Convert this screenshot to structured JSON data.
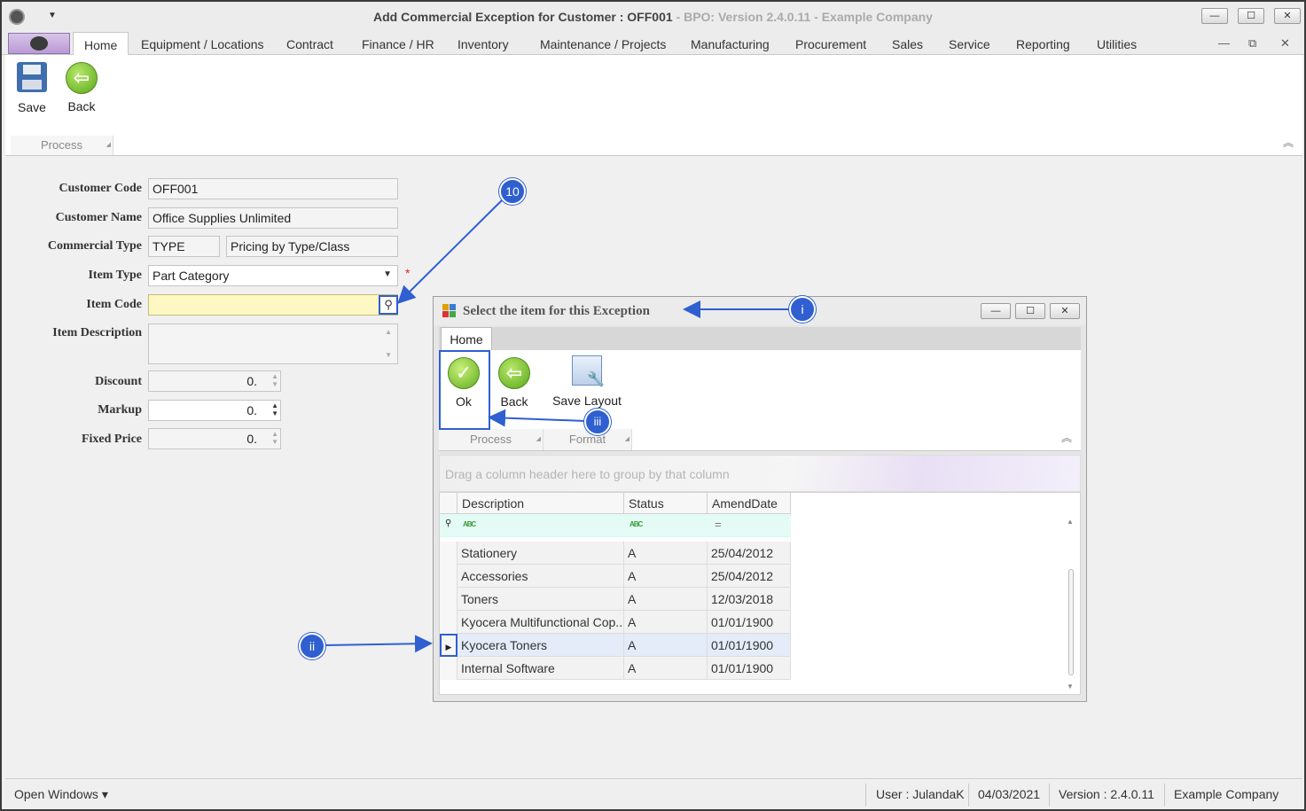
{
  "window": {
    "title_main": "Add Commercial Exception for Customer : OFF001",
    "title_dim": " - BPO: Version 2.4.0.11 - Example Company",
    "min": "—",
    "max": "☐",
    "close": "✕"
  },
  "tabs": {
    "home": "Home",
    "items": [
      "Equipment / Locations",
      "Contract",
      "Finance / HR",
      "Inventory",
      "Maintenance / Projects",
      "Manufacturing",
      "Procurement",
      "Sales",
      "Service",
      "Reporting",
      "Utilities"
    ]
  },
  "ribbon": {
    "save": "Save",
    "back": "Back",
    "process_group": "Process"
  },
  "form": {
    "customer_code_label": "Customer Code",
    "customer_code": "OFF001",
    "customer_name_label": "Customer Name",
    "customer_name": "Office Supplies Unlimited",
    "commercial_type_label": "Commercial Type",
    "commercial_type_code": "TYPE",
    "commercial_type_desc": "Pricing by Type/Class",
    "item_type_label": "Item Type",
    "item_type": "Part Category",
    "item_code_label": "Item Code",
    "item_code": "",
    "item_description_label": "Item Description",
    "discount_label": "Discount",
    "discount": "0.",
    "markup_label": "Markup",
    "markup": "0.",
    "fixed_price_label": "Fixed Price",
    "fixed_price": "0."
  },
  "dialog": {
    "title": "Select the item for this Exception",
    "tab_home": "Home",
    "ok": "Ok",
    "back": "Back",
    "save_layout": "Save Layout",
    "group_process": "Process",
    "group_format": "Format",
    "groupby_hint": "Drag a column header here to group by that column",
    "columns": [
      "Description",
      "Status",
      "AmendDate"
    ],
    "rows": [
      {
        "description": "Stationery",
        "status": "A",
        "date": "25/04/2012"
      },
      {
        "description": "Accessories",
        "status": "A",
        "date": "25/04/2012"
      },
      {
        "description": "Toners",
        "status": "A",
        "date": "12/03/2018"
      },
      {
        "description": "Kyocera Multifunctional Cop...",
        "status": "A",
        "date": "01/01/1900"
      },
      {
        "description": "Kyocera Toners",
        "status": "A",
        "date": "01/01/1900"
      },
      {
        "description": "Internal Software",
        "status": "A",
        "date": "01/01/1900"
      }
    ]
  },
  "statusbar": {
    "open_windows": "Open Windows ▾",
    "user": "User : JulandaK",
    "date": "04/03/2021",
    "version": "Version : 2.4.0.11",
    "company": "Example Company"
  },
  "annotations": {
    "b10": "10",
    "bi": "i",
    "bii": "ii",
    "biii": "iii"
  },
  "colors": {
    "accent": "#2f5fd0",
    "required": "#dd2222",
    "focus_field": "#fdf7c3"
  }
}
